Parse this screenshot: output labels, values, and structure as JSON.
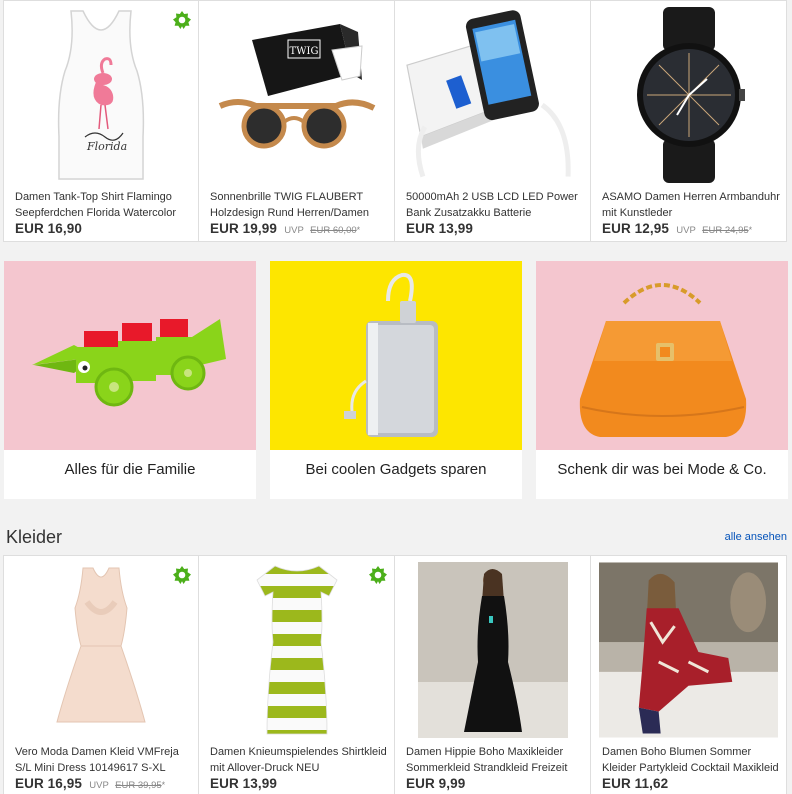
{
  "top_products": [
    {
      "title": "Damen Tank-Top Shirt Flamingo Seepferdchen Florida Watercolor",
      "price": "EUR 16,90",
      "uvp": "",
      "old_price": "",
      "badge": true
    },
    {
      "title": "Sonnenbrille TWIG FLAUBERT Holzdesign Rund Herren/Damen",
      "price": "EUR 19,99",
      "uvp": "UVP",
      "old_price": "EUR 60,00",
      "badge": false
    },
    {
      "title": "50000mAh 2 USB LCD LED Power Bank Zusatzakku Batterie",
      "price": "EUR 13,99",
      "uvp": "",
      "old_price": "",
      "badge": false
    },
    {
      "title": "ASAMO Damen Herren Armbanduhr mit Kunstleder",
      "price": "EUR 12,95",
      "uvp": "UVP",
      "old_price": "EUR 24,95",
      "badge": false
    }
  ],
  "promos": [
    {
      "label": "Alles für die Familie",
      "bg": "#f4c6cf"
    },
    {
      "label": "Bei coolen Gadgets sparen",
      "bg": "#fde600"
    },
    {
      "label": "Schenk dir was bei Mode & Co.",
      "bg": "#f4c6cf"
    }
  ],
  "section": {
    "title": "Kleider",
    "see_all": "alle ansehen"
  },
  "bottom_products": [
    {
      "title": "Vero Moda Damen Kleid VMFreja S/L Mini Dress 10149617 S-XL",
      "price": "EUR 16,95",
      "uvp": "UVP",
      "old_price": "EUR 39,95",
      "badge": true
    },
    {
      "title": "Damen Knieumspielendes Shirtkleid mit Allover-Druck NEU",
      "price": "EUR 13,99",
      "uvp": "",
      "old_price": "",
      "badge": true
    },
    {
      "title": "Damen Hippie Boho Maxikleider Sommerkleid Strandkleid Freizeit",
      "price": "EUR 9,99",
      "uvp": "",
      "old_price": "",
      "badge": false
    },
    {
      "title": "Damen Boho Blumen Sommer Kleider Partykleid Cocktail Maxikleid",
      "price": "EUR 11,62",
      "uvp": "",
      "old_price": "",
      "badge": false
    }
  ],
  "colors": {
    "badge_green": "#4caf1a",
    "link_blue": "#0654ba"
  }
}
